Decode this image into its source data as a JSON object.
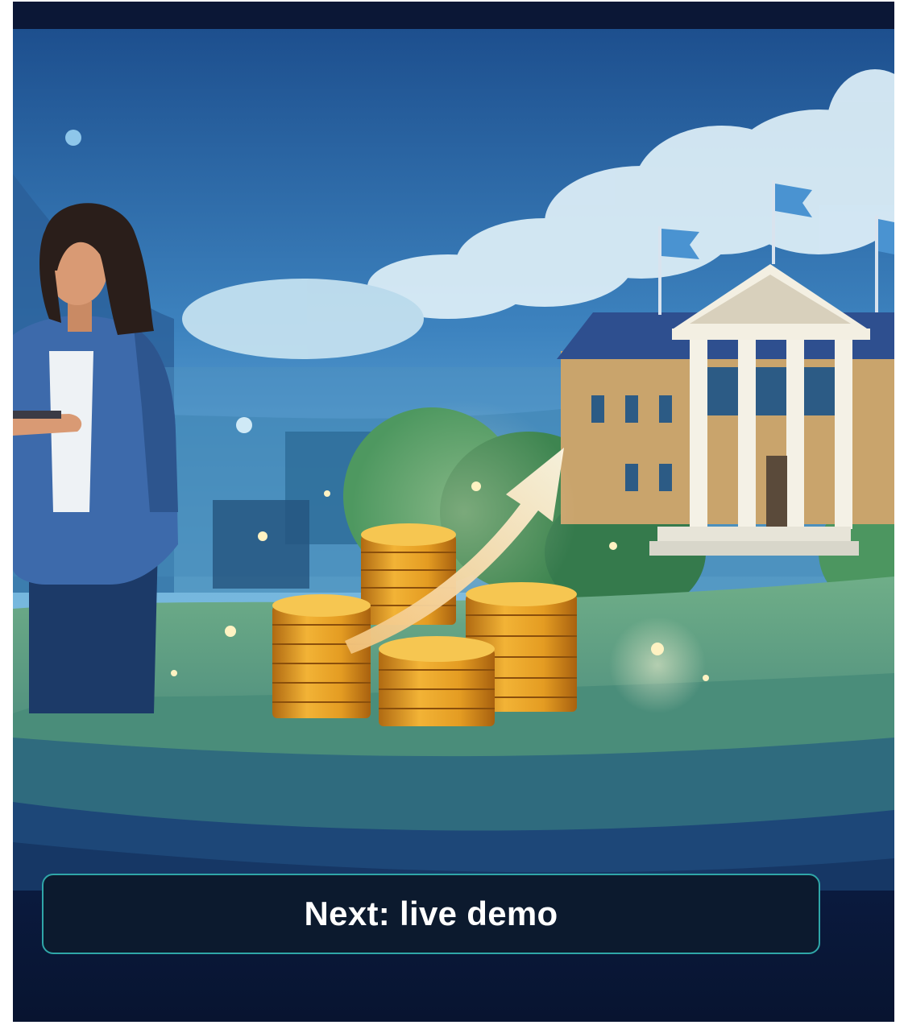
{
  "illustration": {
    "subject": "illustration-finance-growth",
    "elements": [
      "woman-presenter",
      "gold-coin-stacks",
      "growth-arrow",
      "university-building",
      "flags",
      "clouds"
    ]
  },
  "caption": {
    "text": "Next: live demo"
  },
  "colors": {
    "frame_background": "#0a1a3c",
    "caption_border": "#2fa6a8",
    "caption_background": "#0c1a2e",
    "caption_text": "#ffffff"
  }
}
